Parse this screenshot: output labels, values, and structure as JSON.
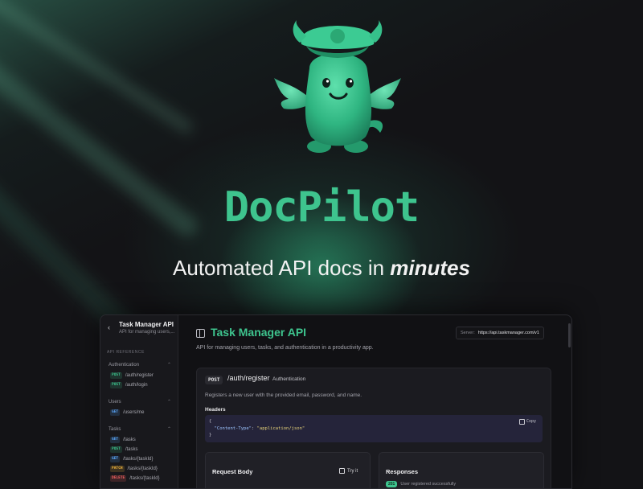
{
  "brand": {
    "name": "DocPilot"
  },
  "tagline": {
    "text": "Automated API docs in",
    "emphasis": "minutes"
  },
  "sidebar": {
    "title": "Task Manager API",
    "subtitle": "API for managing users,...",
    "section_label": "API REFERENCE",
    "groups": [
      {
        "label": "Authentication",
        "items": [
          {
            "method": "POST",
            "path": "/auth/register"
          },
          {
            "method": "POST",
            "path": "/auth/login"
          }
        ]
      },
      {
        "label": "Users",
        "items": [
          {
            "method": "GET",
            "path": "/users/me"
          }
        ]
      },
      {
        "label": "Tasks",
        "items": [
          {
            "method": "GET",
            "path": "/tasks"
          },
          {
            "method": "POST",
            "path": "/tasks"
          },
          {
            "method": "GET",
            "path": "/tasks/{taskId}"
          },
          {
            "method": "PATCH",
            "path": "/tasks/{taskId}"
          },
          {
            "method": "DELETE",
            "path": "/tasks/{taskId}"
          }
        ]
      }
    ]
  },
  "main": {
    "title": "Task Manager API",
    "server_label": "Server:",
    "server_url": "https://api.taskmanager.com/v1",
    "description": "API for managing users, tasks, and authentication in a productivity app.",
    "endpoint": {
      "method": "POST",
      "path": "/auth/register",
      "tag": "Authentication",
      "description": "Registers a new user with the provided email, password, and name.",
      "headers_label": "Headers",
      "code_open": "{",
      "code_key": "\"Content-Type\"",
      "code_value": "\"application/json\"",
      "code_close": "}",
      "copy_label": "Copy",
      "request_body_label": "Request Body",
      "try_it_label": "Try it",
      "responses_label": "Responses",
      "response_code": "201",
      "response_text": "User registered successfully"
    }
  },
  "colors": {
    "accent": "#3ec48e",
    "background": "#131316"
  }
}
